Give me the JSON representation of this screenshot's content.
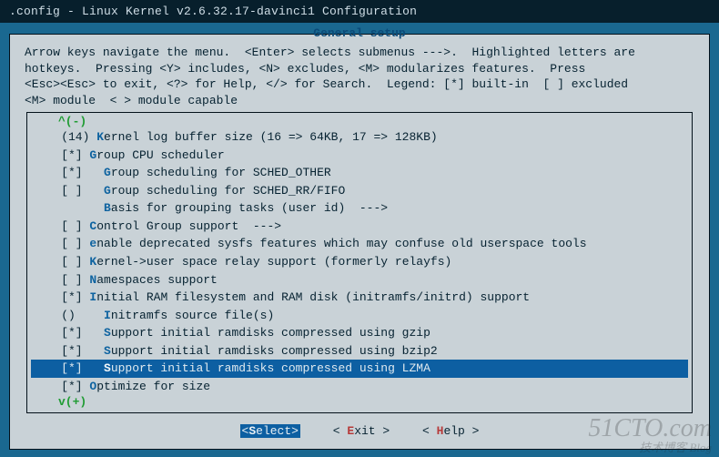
{
  "title": ".config - Linux Kernel v2.6.32.17-davinci1 Configuration",
  "panel_title": "General setup",
  "help_lines": [
    "Arrow keys navigate the menu.  <Enter> selects submenus --->.  Highlighted letters are",
    "hotkeys.  Pressing <Y> includes, <N> excludes, <M> modularizes features.  Press",
    "<Esc><Esc> to exit, <?> for Help, </> for Search.  Legend: [*] built-in  [ ] excluded",
    "<M> module  < > module capable"
  ],
  "scroll": {
    "up": "^(-)",
    "down": "v(+)"
  },
  "items": [
    {
      "indent": 4,
      "mark": "(14)",
      "hotkey": "K",
      "label": "ernel log buffer size (16 => 64KB, 17 => 128KB)",
      "space_before_hk": true
    },
    {
      "indent": 4,
      "mark": "[*] ",
      "hotkey": "G",
      "label": "roup CPU scheduler"
    },
    {
      "indent": 4,
      "mark": "[*]   ",
      "hotkey": "G",
      "label": "roup scheduling for SCHED_OTHER"
    },
    {
      "indent": 4,
      "mark": "[ ]   ",
      "hotkey": "G",
      "label": "roup scheduling for SCHED_RR/FIFO"
    },
    {
      "indent": 4,
      "mark": "      ",
      "hotkey": "B",
      "label": "asis for grouping tasks (user id)  --->"
    },
    {
      "indent": 4,
      "mark": "[ ] ",
      "hotkey": "C",
      "label": "ontrol Group support  --->"
    },
    {
      "indent": 4,
      "mark": "[ ] ",
      "hotkey": "e",
      "label": "nable deprecated sysfs features which may confuse old userspace tools"
    },
    {
      "indent": 4,
      "mark": "[ ] ",
      "hotkey": "K",
      "label": "ernel->user space relay support (formerly relayfs)"
    },
    {
      "indent": 4,
      "mark": "[ ] ",
      "hotkey": "N",
      "label": "amespaces support"
    },
    {
      "indent": 4,
      "mark": "[*] ",
      "hotkey": "I",
      "label": "nitial RAM filesystem and RAM disk (initramfs/initrd) support"
    },
    {
      "indent": 4,
      "mark": "()    ",
      "hotkey": "I",
      "label": "nitramfs source file(s)"
    },
    {
      "indent": 4,
      "mark": "[*]   ",
      "hotkey": "S",
      "label": "upport initial ramdisks compressed using gzip"
    },
    {
      "indent": 4,
      "mark": "[*]   ",
      "hotkey": "S",
      "label": "upport initial ramdisks compressed using bzip2"
    },
    {
      "indent": 4,
      "mark": "[*]   ",
      "hotkey": "S",
      "label": "upport initial ramdisks compressed using LZMA",
      "selected": true
    },
    {
      "indent": 4,
      "mark": "[*] ",
      "hotkey": "O",
      "label": "ptimize for size"
    }
  ],
  "buttons": {
    "select": {
      "pre": "<",
      "hk": "S",
      "post": "elect>",
      "active": true
    },
    "exit": {
      "pre": "< ",
      "hk": "E",
      "post": "xit >"
    },
    "help": {
      "pre": "< ",
      "hk": "H",
      "post": "elp >"
    }
  },
  "watermark": {
    "big": "51CTO.com",
    "small": "技术博客  Blog"
  }
}
